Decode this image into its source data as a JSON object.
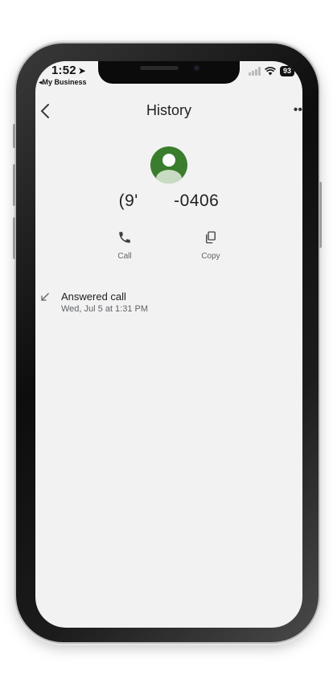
{
  "status_bar": {
    "time": "1:52",
    "back_app": "My Business",
    "battery": "93"
  },
  "header": {
    "title": "History"
  },
  "contact": {
    "phone_number": "(9'       -0406"
  },
  "actions": [
    {
      "label": "Call",
      "icon": "phone-icon"
    },
    {
      "label": "Copy",
      "icon": "copy-icon"
    }
  ],
  "history": [
    {
      "title": "Answered call",
      "timestamp": "Wed, Jul 5 at 1:31 PM",
      "icon": "incoming-arrow-icon"
    }
  ],
  "colors": {
    "avatar": "#3a7d2c",
    "background": "#f2f2f2",
    "text_primary": "#202124",
    "text_secondary": "#5f6368"
  }
}
